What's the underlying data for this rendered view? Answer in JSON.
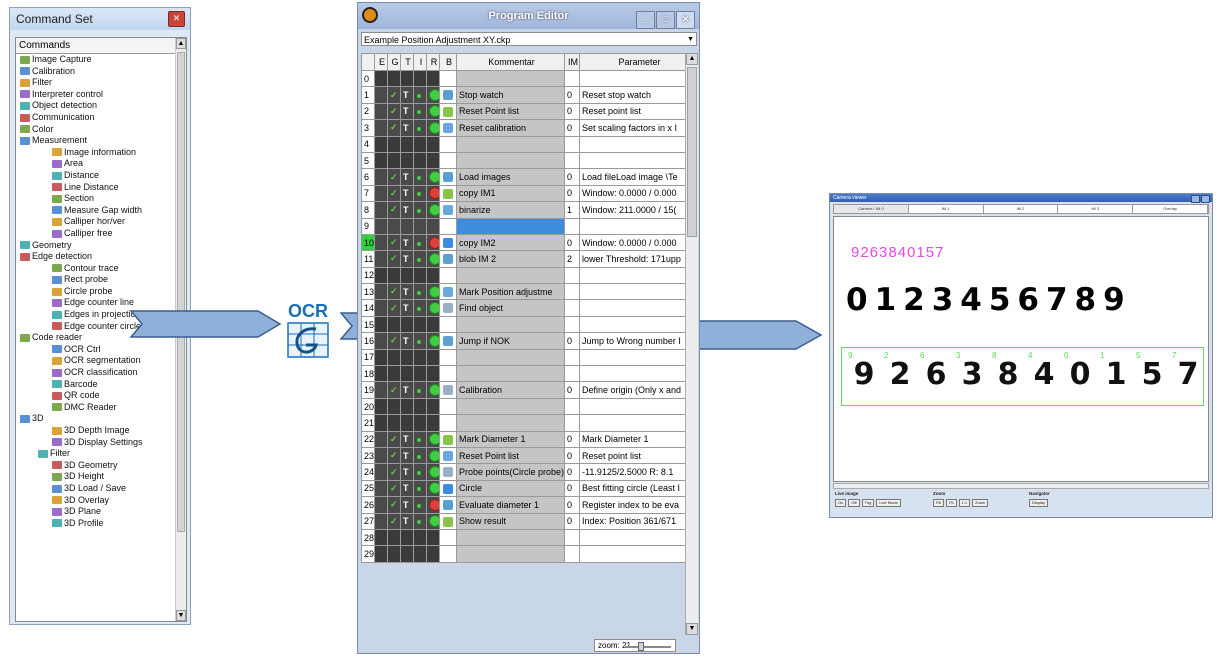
{
  "command_set": {
    "title": "Command Set",
    "header": "Commands",
    "items": [
      {
        "label": "Image Capture",
        "level": 0
      },
      {
        "label": "Calibration",
        "level": 0
      },
      {
        "label": "Filter",
        "level": 0
      },
      {
        "label": "Interpreter control",
        "level": 0
      },
      {
        "label": "Object detection",
        "level": 0
      },
      {
        "label": "Communication",
        "level": 0
      },
      {
        "label": "Color",
        "level": 0
      },
      {
        "label": "Measurement",
        "level": 0
      },
      {
        "label": "Image information",
        "level": 1
      },
      {
        "label": "Area",
        "level": 1
      },
      {
        "label": "Distance",
        "level": 1
      },
      {
        "label": "Line Distance",
        "level": 1
      },
      {
        "label": "Section",
        "level": 1
      },
      {
        "label": "Measure Gap width",
        "level": 1
      },
      {
        "label": "Calliper hor/ver",
        "level": 1
      },
      {
        "label": "Calliper free",
        "level": 1
      },
      {
        "label": "Geometry",
        "level": 0
      },
      {
        "label": "Edge detection",
        "level": 0
      },
      {
        "label": "Contour trace",
        "level": 1
      },
      {
        "label": "Rect probe",
        "level": 1
      },
      {
        "label": "Circle probe",
        "level": 1
      },
      {
        "label": "Edge counter line",
        "level": 1
      },
      {
        "label": "Edges in projection",
        "level": 1
      },
      {
        "label": "Edge counter circle",
        "level": 1
      },
      {
        "label": "Code reader",
        "level": 0
      },
      {
        "label": "OCR Ctrl",
        "level": 1
      },
      {
        "label": "OCR segmentation",
        "level": 1
      },
      {
        "label": "OCR classification",
        "level": 1
      },
      {
        "label": "Barcode",
        "level": 1
      },
      {
        "label": "QR code",
        "level": 1
      },
      {
        "label": "DMC Reader",
        "level": 1
      },
      {
        "label": "3D",
        "level": 0
      },
      {
        "label": "3D Depth Image",
        "level": 1
      },
      {
        "label": "3D Display Settings",
        "level": 1
      },
      {
        "label": "Filter",
        "level": 2
      },
      {
        "label": "3D Geometry",
        "level": 1
      },
      {
        "label": "3D Height",
        "level": 1
      },
      {
        "label": "3D Load / Save",
        "level": 1
      },
      {
        "label": "3D Overlay",
        "level": 1
      },
      {
        "label": "3D Plane",
        "level": 1
      },
      {
        "label": "3D Profile",
        "level": 1
      }
    ]
  },
  "ocr_logo": {
    "text": "OCR"
  },
  "program_editor": {
    "title": "Program Editor",
    "file": "Example Position Adjustment XY.ckp",
    "columns": [
      "",
      "E",
      "G",
      "T",
      "I",
      "R",
      "B",
      "Kommentar",
      "IM",
      "Parameter"
    ],
    "rows": [
      {
        "n": "0",
        "kind": "blank",
        "comment": "",
        "im": "",
        "param": ""
      },
      {
        "n": "1",
        "kind": "cmd",
        "r": "g",
        "comment": "Stop watch",
        "im": "0",
        "param": "Reset stop watch"
      },
      {
        "n": "2",
        "kind": "cmd",
        "r": "g",
        "comment": "Reset Point list",
        "im": "0",
        "param": "Reset point list"
      },
      {
        "n": "3",
        "kind": "cmd",
        "r": "g",
        "comment": "Reset calibration",
        "im": "0",
        "param": "Set scaling factors in x I"
      },
      {
        "n": "4",
        "kind": "blank",
        "comment": "",
        "im": "",
        "param": ""
      },
      {
        "n": "5",
        "kind": "blank",
        "comment": "",
        "im": "",
        "param": ""
      },
      {
        "n": "6",
        "kind": "cmd",
        "r": "g",
        "comment": "Load images",
        "im": "0",
        "param": "Load fileLoad image \\Te"
      },
      {
        "n": "7",
        "kind": "cmd",
        "r": "r",
        "comment": "copy IM1",
        "im": "0",
        "param": "Window: 0.0000 / 0.000"
      },
      {
        "n": "8",
        "kind": "cmd",
        "r": "g",
        "comment": "binarize",
        "im": "1",
        "param": "Window: 211.0000 / 15("
      },
      {
        "n": "9",
        "kind": "sel",
        "comment": "",
        "im": "",
        "param": ""
      },
      {
        "n": "10",
        "kind": "cmd",
        "r": "r",
        "green": true,
        "comment": "copy IM2",
        "im": "0",
        "param": "Window: 0.0000 / 0.000"
      },
      {
        "n": "11",
        "kind": "cmd",
        "r": "g",
        "comment": "blob IM 2",
        "im": "2",
        "param": "lower Threshold: 171upp"
      },
      {
        "n": "12",
        "kind": "blank",
        "comment": "",
        "im": "",
        "param": ""
      },
      {
        "n": "13",
        "kind": "cmd",
        "r": "g",
        "comment": "Mark Position adjustme",
        "im": "",
        "param": ""
      },
      {
        "n": "14",
        "kind": "cmd",
        "r": "g",
        "comment": "Find object",
        "im": "",
        "param": ""
      },
      {
        "n": "15",
        "kind": "blank",
        "comment": "",
        "im": "",
        "param": ""
      },
      {
        "n": "16",
        "kind": "cmd",
        "r": "g",
        "comment": "Jump if NOK",
        "im": "0",
        "param": "Jump to Wrong number I"
      },
      {
        "n": "17",
        "kind": "blank",
        "comment": "",
        "im": "",
        "param": ""
      },
      {
        "n": "18",
        "kind": "blank",
        "comment": "",
        "im": "",
        "param": ""
      },
      {
        "n": "19",
        "kind": "cmd",
        "r": "g",
        "comment": "Calibration",
        "im": "0",
        "param": "Define origin (Only x and"
      },
      {
        "n": "20",
        "kind": "blank",
        "comment": "",
        "im": "",
        "param": ""
      },
      {
        "n": "21",
        "kind": "blank",
        "comment": "",
        "im": "",
        "param": ""
      },
      {
        "n": "22",
        "kind": "cmd",
        "r": "g",
        "comment": "Mark Diameter 1",
        "im": "0",
        "param": "Mark Diameter 1"
      },
      {
        "n": "23",
        "kind": "cmd",
        "r": "g",
        "comment": "Reset Point list",
        "im": "0",
        "param": "Reset point list"
      },
      {
        "n": "24",
        "kind": "cmd",
        "r": "g",
        "comment": "Probe points(Circle probe)",
        "im": "0",
        "param": "-11.9125/2.5000 R: 8.1"
      },
      {
        "n": "25",
        "kind": "cmd",
        "r": "g",
        "comment": "Circle",
        "im": "0",
        "param": "Best fitting circle (Least I"
      },
      {
        "n": "26",
        "kind": "cmd",
        "r": "r",
        "comment": "Evaluate diameter 1",
        "im": "0",
        "param": "Register index to be eva"
      },
      {
        "n": "27",
        "kind": "cmd",
        "r": "g",
        "comment": "Show result",
        "im": "0",
        "param": "Index: Position 361/671"
      },
      {
        "n": "28",
        "kind": "blank",
        "comment": "",
        "im": "",
        "param": ""
      },
      {
        "n": "29",
        "kind": "blank",
        "comment": "",
        "im": "",
        "param": ""
      }
    ],
    "zoom_label": "zoom: 21"
  },
  "camera_viewer": {
    "title": "Camera viewer",
    "tabs": [
      "Camera / IM 0",
      "IM 1",
      "IM 2",
      "IM 3",
      "Overlay"
    ],
    "recognized_string": "9263840157",
    "reference_digits": "0123456789",
    "detected_digits": [
      {
        "small": "9",
        "big": "9"
      },
      {
        "small": "2",
        "big": "2"
      },
      {
        "small": "6",
        "big": "6"
      },
      {
        "small": "3",
        "big": "3"
      },
      {
        "small": "8",
        "big": "8"
      },
      {
        "small": "4",
        "big": "4"
      },
      {
        "small": "0",
        "big": "0"
      },
      {
        "small": "1",
        "big": "1"
      },
      {
        "small": "5",
        "big": "5"
      },
      {
        "small": "7",
        "big": "7"
      }
    ],
    "bottom": {
      "live_image": {
        "title": "Live image",
        "buttons": [
          "On",
          "Off",
          "Trig",
          "Live Mode"
        ]
      },
      "zoom": {
        "title": "Zoom",
        "buttons": [
          "Fill",
          "Fit",
          "1:1",
          "Zoom"
        ]
      },
      "navigator": {
        "title": "Navigator",
        "buttons": [
          "Display"
        ]
      }
    }
  }
}
